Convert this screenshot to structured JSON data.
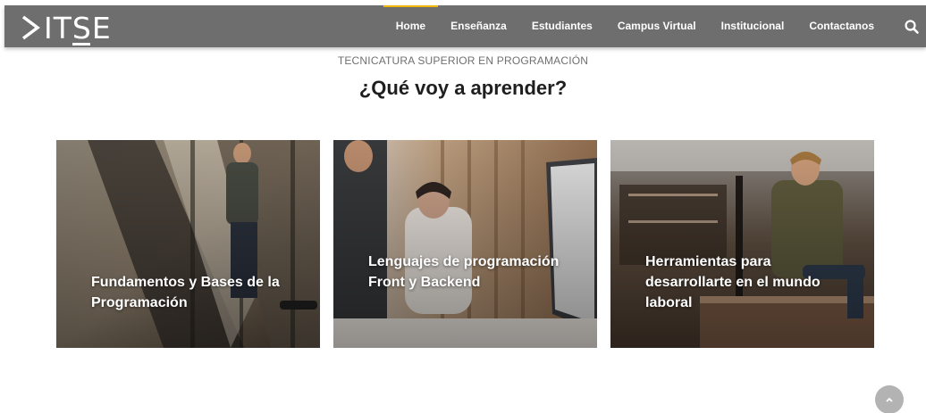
{
  "brand": {
    "logo_text": "ITSE"
  },
  "nav": {
    "items": [
      {
        "label": "Home",
        "active": true
      },
      {
        "label": "Enseñanza",
        "active": false
      },
      {
        "label": "Estudiantes",
        "active": false
      },
      {
        "label": "Campus Virtual",
        "active": false
      },
      {
        "label": "Institucional",
        "active": false
      },
      {
        "label": "Contactanos",
        "active": false
      }
    ],
    "search_icon": "search-icon"
  },
  "section": {
    "subtitle": "TECNICATURA SUPERIOR EN PROGRAMACIÓN",
    "heading": "¿Qué voy a aprender?"
  },
  "cards": [
    {
      "title": "Fundamentos y Bases de la Programación"
    },
    {
      "title": "Lenguajes de programación Front y Backend"
    },
    {
      "title": "Herramientas para desarrollarte en el mundo laboral"
    }
  ],
  "colors": {
    "navbar": "#6e6e6e",
    "active_indicator": "#f2b705",
    "heading": "#1e1e1e"
  }
}
